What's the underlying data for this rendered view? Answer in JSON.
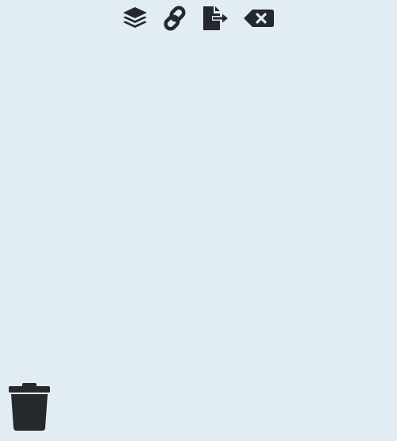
{
  "colors": {
    "background": "#e1ecf3",
    "icon": "#25282c"
  },
  "toolbar": {
    "items": [
      {
        "icon": "layers-icon"
      },
      {
        "icon": "link-icon"
      },
      {
        "icon": "file-export-icon"
      },
      {
        "icon": "backspace-clear-icon"
      }
    ]
  },
  "trash": {
    "icon": "trash-icon"
  }
}
